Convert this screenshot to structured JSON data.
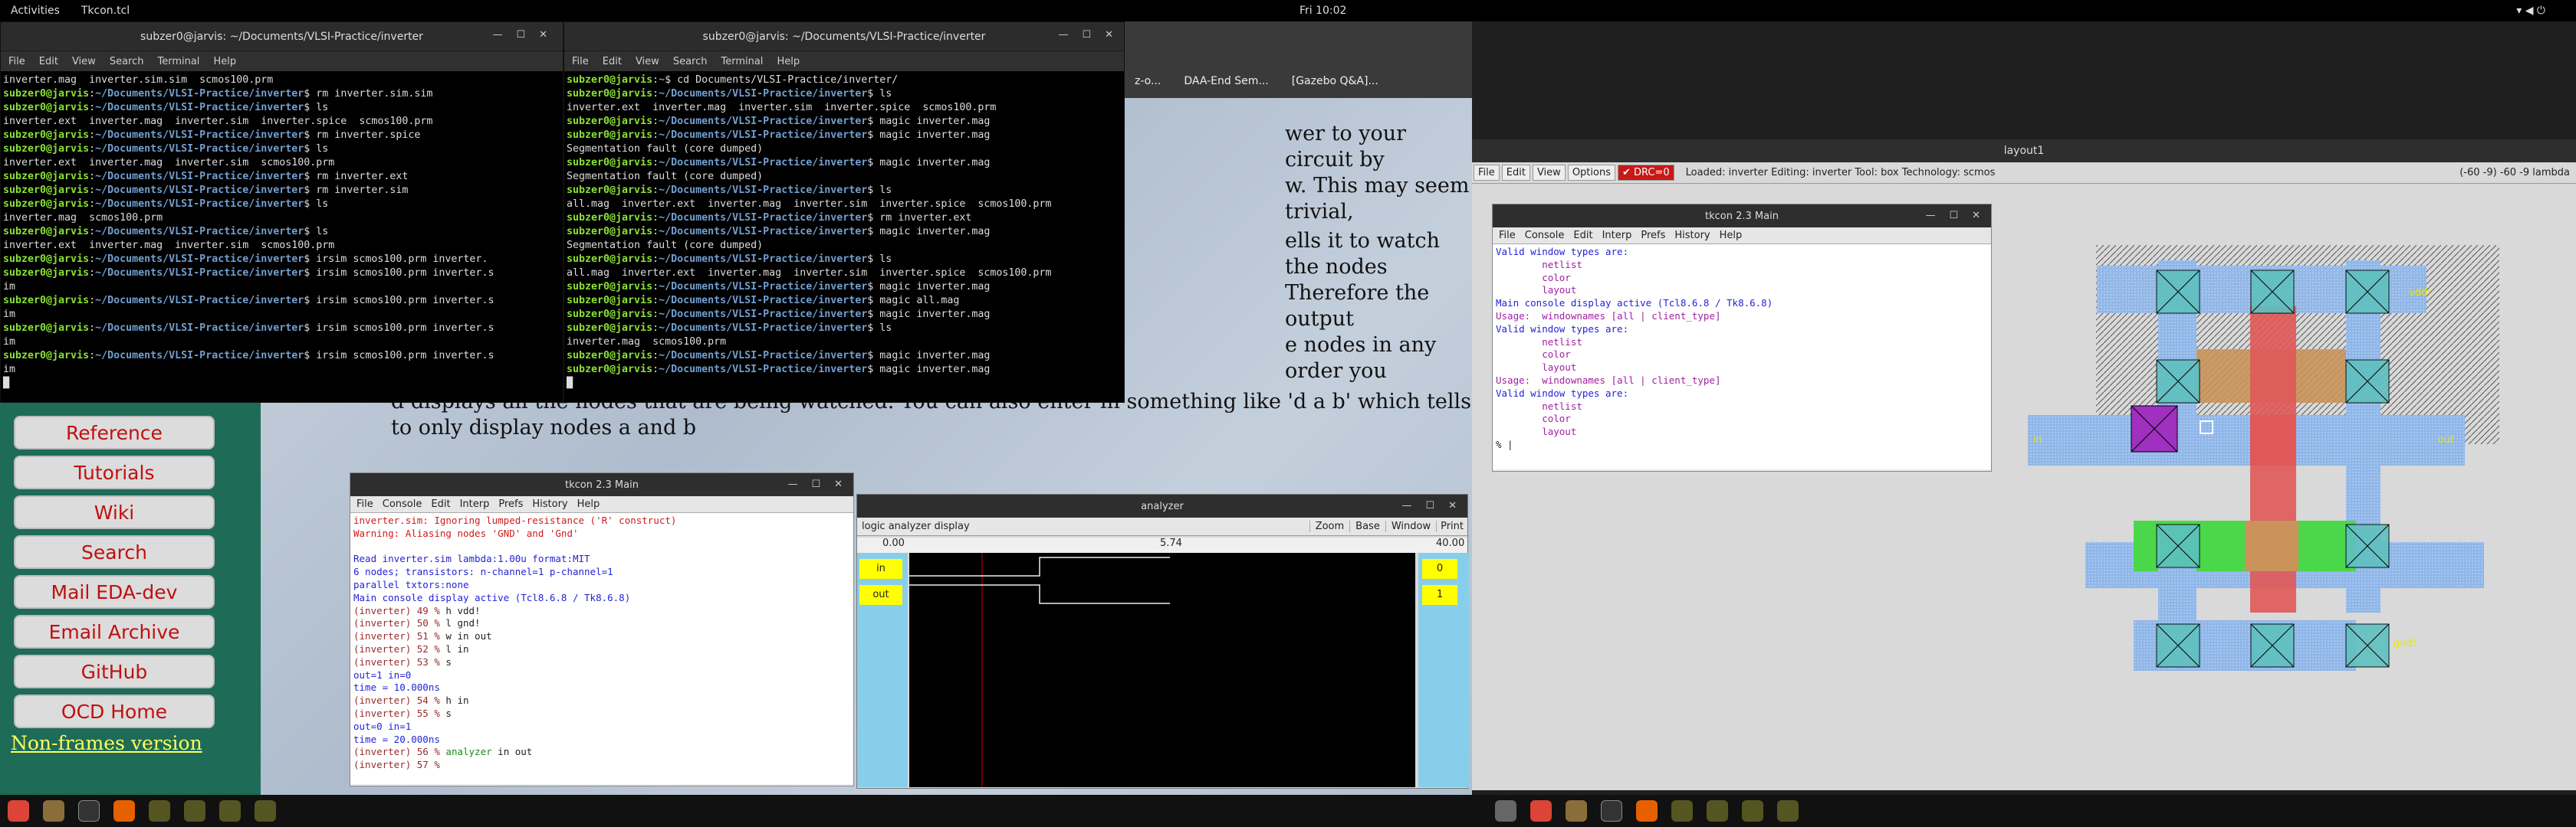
{
  "topbar": {
    "activities": "Activities",
    "app": "Tkcon.tcl",
    "clock": "Fri 10:02"
  },
  "term1": {
    "title": "subzer0@jarvis: ~/Documents/VLSI-Practice/inverter",
    "menu": [
      "File",
      "Edit",
      "View",
      "Search",
      "Terminal",
      "Help"
    ]
  },
  "term2": {
    "title": "subzer0@jarvis: ~/Documents/VLSI-Practice/inverter",
    "menu": [
      "File",
      "Edit",
      "View",
      "Search",
      "Terminal",
      "Help"
    ]
  },
  "prompt": "subzer0@jarvis",
  "path": ":~/Documents/VLSI-Practice/inverter$",
  "browser": {
    "tabs": [
      "z-o...",
      "DAA-End Sem...",
      "[Gazebo Q&A]..."
    ],
    "text1": "wer to your circuit by",
    "text2": "w. This may seem trivial,",
    "text3": "ells it to watch the nodes",
    "text4": "Therefore the output",
    "text5": "e nodes in any order you",
    "text6": "d displays all the nodes that are being watched. You can also enter in something like 'd a b' which tells IRSIM",
    "text7": "to only display nodes a and b",
    "nav": [
      "Reference",
      "Tutorials",
      "Wiki",
      "Search",
      "Mail EDA-dev",
      "Email Archive",
      "GitHub",
      "OCD Home"
    ],
    "nonframes": "Non-frames version"
  },
  "tkmain": {
    "title": "tkcon 2.3 Main",
    "menu": [
      "File",
      "Console",
      "Edit",
      "Interp",
      "Prefs",
      "History",
      "Help"
    ]
  },
  "tkmain2": {
    "title": "tkcon 2.3 Main",
    "menu": [
      "File",
      "Console",
      "Edit",
      "Interp",
      "Prefs",
      "History",
      "Help"
    ]
  },
  "analyzer": {
    "title": "analyzer",
    "label": "logic analyzer display",
    "buttons": [
      "Zoom",
      "Base",
      "Window",
      "Print"
    ],
    "t0": "0.00",
    "tm": "5.74",
    "t1": "40.00",
    "signals": [
      "in",
      "out"
    ],
    "values": [
      "0",
      "1"
    ]
  },
  "layout": {
    "title": "layout1",
    "menu": [
      "File",
      "Edit",
      "View",
      "Options"
    ],
    "drc": "DRC=0",
    "status": "Loaded: inverter Editing: inverter Tool: box  Technology: scmos",
    "coords": "(-60 -9) -60 -9 lambda",
    "labels": {
      "in": "in",
      "out": "out",
      "vdd": "vdd!",
      "gnd": "gnd!"
    }
  }
}
